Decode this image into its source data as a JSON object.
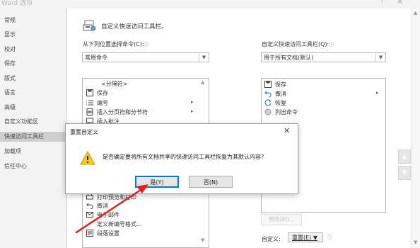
{
  "window": {
    "title": "Word 选项",
    "help_glyph": "?",
    "close_glyph": "✕"
  },
  "sidebar": {
    "items": [
      {
        "label": "常规"
      },
      {
        "label": "显示"
      },
      {
        "label": "校对"
      },
      {
        "label": "保存"
      },
      {
        "label": "版式"
      },
      {
        "label": "语言"
      },
      {
        "label": "高级"
      },
      {
        "label": "自定义功能区"
      },
      {
        "label": "快速访问工具栏"
      },
      {
        "label": "加载项"
      },
      {
        "label": "信任中心"
      }
    ],
    "active_index": 8
  },
  "main": {
    "heading": "自定义快速访问工具栏。",
    "choose_label": "从下列位置选择命令(C):",
    "choose_value": "常用命令",
    "customize_label": "自定义快速访问工具栏(Q):",
    "customize_value": "用于所有文档(默认)",
    "info_glyph": "ⓘ",
    "left_list": [
      {
        "label": "<分隔符>",
        "icon": "separator-icon"
      },
      {
        "label": "保存",
        "icon": "save-icon"
      },
      {
        "label": "编号",
        "icon": "numbering-icon",
        "submenu": true
      },
      {
        "label": "插入分页符和分节符",
        "icon": "page-break-icon",
        "submenu": true
      },
      {
        "label": "插入批注",
        "icon": "comment-icon"
      },
      {
        "label": "打印预览和打印",
        "icon": "print-preview-icon"
      },
      {
        "label": "撤消",
        "icon": "undo-icon"
      },
      {
        "label": "电子邮件",
        "icon": "email-icon"
      },
      {
        "label": "定义新编号格式...",
        "icon": "none"
      },
      {
        "label": "段落设置",
        "icon": "paragraph-icon"
      }
    ],
    "right_list": [
      {
        "label": "保存",
        "icon": "save-icon"
      },
      {
        "label": "撤消",
        "icon": "undo-icon",
        "submenu": true
      },
      {
        "label": "恢复",
        "icon": "redo-icon"
      },
      {
        "label": "列出命令",
        "icon": "list-commands-icon"
      }
    ],
    "modify_button": "修改(M)...",
    "customize_footer_label": "自定义:",
    "reset_button": "重置(E) ▼"
  },
  "dialog": {
    "title": "重置自定义",
    "message": "是否确定要将所有文档共享的快速访问工具栏恢复为其默认内容?",
    "yes_button": "是(Y)",
    "no_button": "否(N)",
    "close_glyph": "✕"
  },
  "colors": {
    "annotation_arrow": "#e02020",
    "accent": "#0078d7"
  }
}
